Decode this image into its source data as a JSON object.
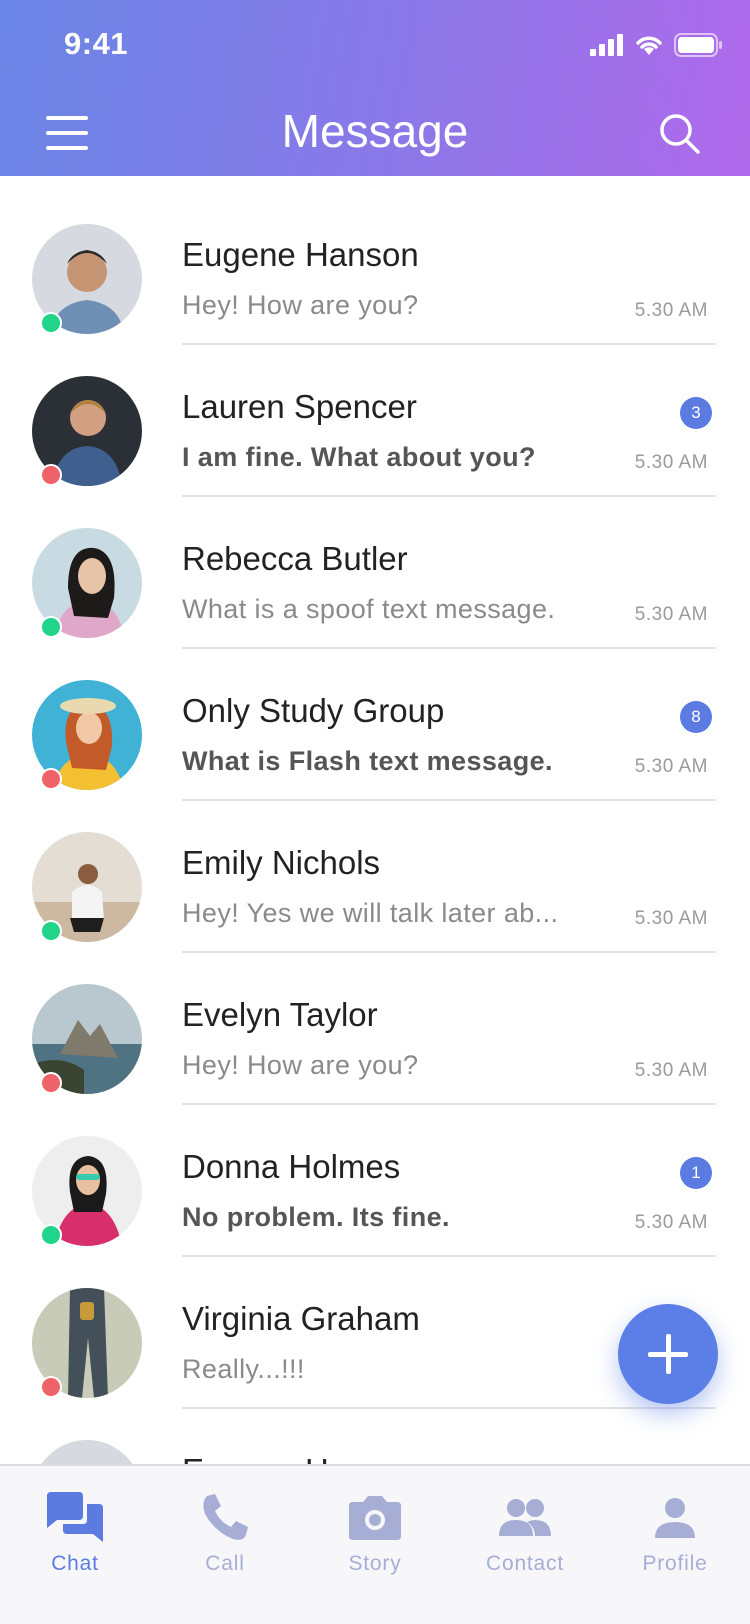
{
  "status_bar": {
    "time": "9:41"
  },
  "header": {
    "title": "Message"
  },
  "colors": {
    "accent": "#5b7be0",
    "online": "#21d48a",
    "offline": "#f0626a",
    "inactive_tab": "#a6aed6"
  },
  "conversations": [
    {
      "name": "Eugene Hanson",
      "preview": "Hey! How are you?",
      "time": "5.30 AM",
      "badge": "",
      "status": "online",
      "unread": false
    },
    {
      "name": "Lauren Spencer",
      "preview": "I am fine. What about you?",
      "time": "5.30 AM",
      "badge": "3",
      "status": "offline",
      "unread": true
    },
    {
      "name": "Rebecca Butler",
      "preview": "What is a spoof text message.",
      "time": "5.30 AM",
      "badge": "",
      "status": "online",
      "unread": false
    },
    {
      "name": "Only Study Group",
      "preview": "What is Flash text message.",
      "time": "5.30 AM",
      "badge": "8",
      "status": "offline",
      "unread": true
    },
    {
      "name": "Emily Nichols",
      "preview": "Hey! Yes we will talk later ab...",
      "time": "5.30 AM",
      "badge": "",
      "status": "online",
      "unread": false
    },
    {
      "name": "Evelyn Taylor",
      "preview": "Hey! How are you?",
      "time": "5.30 AM",
      "badge": "",
      "status": "offline",
      "unread": false
    },
    {
      "name": "Donna Holmes",
      "preview": "No problem. Its fine.",
      "time": "5.30 AM",
      "badge": "1",
      "status": "online",
      "unread": true
    },
    {
      "name": "Virginia Graham",
      "preview": "Really...!!!",
      "time": "",
      "badge": "",
      "status": "offline",
      "unread": false
    },
    {
      "name": "Eugene Hanson",
      "preview": "",
      "time": "",
      "badge": "",
      "status": "online",
      "unread": false
    }
  ],
  "tabs": [
    {
      "label": "Chat",
      "icon": "chat-icon",
      "active": true
    },
    {
      "label": "Call",
      "icon": "phone-icon",
      "active": false
    },
    {
      "label": "Story",
      "icon": "camera-icon",
      "active": false
    },
    {
      "label": "Contact",
      "icon": "contacts-icon",
      "active": false
    },
    {
      "label": "Profile",
      "icon": "profile-icon",
      "active": false
    }
  ]
}
